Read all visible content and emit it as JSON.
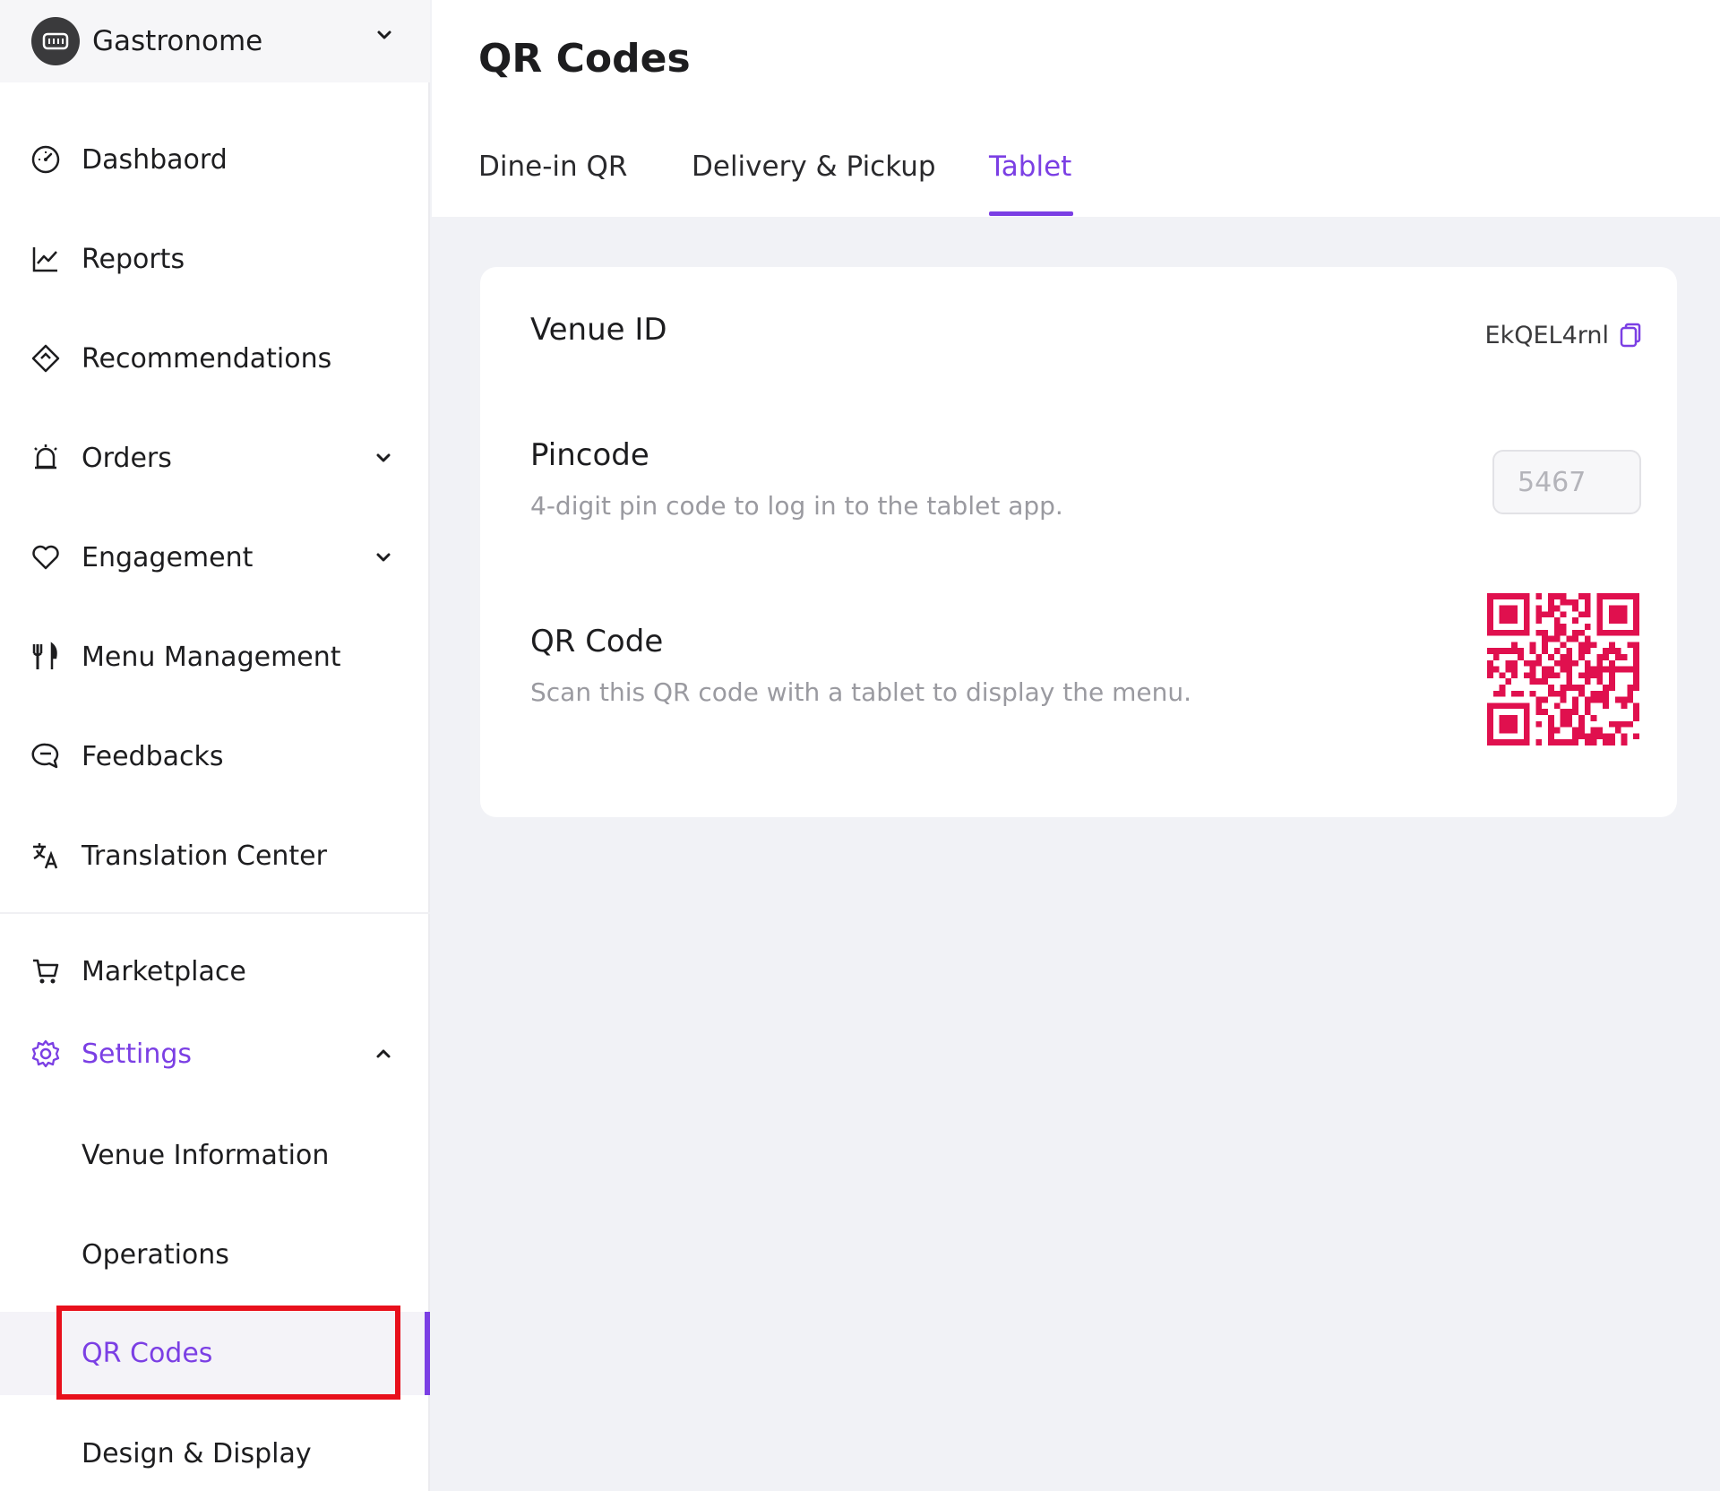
{
  "venue": {
    "name": "Gastronome"
  },
  "sidebar": {
    "items": [
      {
        "label": "Dashbaord",
        "icon": "dashboard-gauge-icon"
      },
      {
        "label": "Reports",
        "icon": "line-chart-icon"
      },
      {
        "label": "Recommendations",
        "icon": "recommendations-diamond-icon"
      },
      {
        "label": "Orders",
        "icon": "bell-icon"
      },
      {
        "label": "Engagement",
        "icon": "heart-icon"
      },
      {
        "label": "Menu Management",
        "icon": "fork-knife-icon"
      },
      {
        "label": "Feedbacks",
        "icon": "chat-bubble-icon"
      },
      {
        "label": "Translation Center",
        "icon": "translate-icon"
      },
      {
        "label": "Marketplace",
        "icon": "cart-icon"
      },
      {
        "label": "Settings",
        "icon": "gear-icon"
      }
    ],
    "settings_sub": [
      {
        "label": "Venue Information"
      },
      {
        "label": "Operations"
      },
      {
        "label": "QR Codes"
      },
      {
        "label": "Design & Display"
      }
    ]
  },
  "page": {
    "title": "QR Codes"
  },
  "tabs": [
    {
      "label": "Dine-in QR"
    },
    {
      "label": "Delivery & Pickup"
    },
    {
      "label": "Tablet"
    }
  ],
  "card": {
    "venue_id": {
      "title": "Venue ID",
      "value": "EkQEL4rnl"
    },
    "pincode": {
      "title": "Pincode",
      "description": "4-digit pin code to log in to the tablet app.",
      "value": "5467"
    },
    "qr": {
      "title": "QR Code",
      "description": "Scan this QR code with a tablet to display the menu."
    }
  },
  "colors": {
    "accent": "#7b3fe4",
    "qr": "#e0104e",
    "highlight": "#e8101c"
  }
}
